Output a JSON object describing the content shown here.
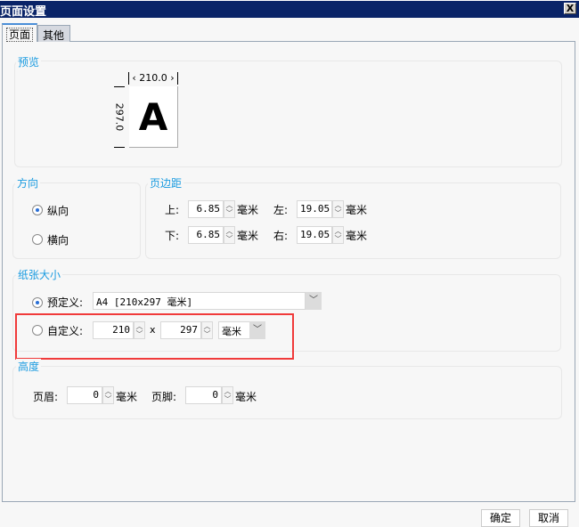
{
  "window": {
    "title": "页面设置",
    "close": "X"
  },
  "tabs": [
    {
      "label": "页面"
    },
    {
      "label": "其他"
    }
  ],
  "preview": {
    "label": "预览",
    "width": "210.0",
    "height": "297.0",
    "letter": "A"
  },
  "orientation": {
    "label": "方向",
    "portrait": "纵向",
    "landscape": "横向",
    "selected": "portrait"
  },
  "margins": {
    "label": "页边距",
    "top_label": "上:",
    "top": "6.85",
    "left_label": "左:",
    "left": "19.05",
    "bottom_label": "下:",
    "bottom": "6.85",
    "right_label": "右:",
    "right": "19.05",
    "unit": "毫米"
  },
  "paper": {
    "label": "纸张大小",
    "predefined_label": "预定义:",
    "predefined_value": "A4 [210x297 毫米]",
    "custom_label": "自定义:",
    "custom_width": "210",
    "times": "x",
    "custom_height": "297",
    "custom_unit": "毫米"
  },
  "height": {
    "label": "高度",
    "header_label": "页眉:",
    "header": "0",
    "footer_label": "页脚:",
    "footer": "0",
    "unit": "毫米"
  },
  "buttons": {
    "ok": "确定",
    "cancel": "取消"
  },
  "colors": {
    "titlebar": "#0a2468",
    "accent": "#1a9be0",
    "highlight": "#f03a3a"
  }
}
